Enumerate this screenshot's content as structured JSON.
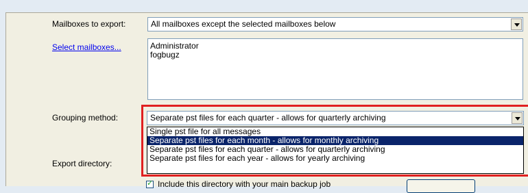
{
  "form": {
    "mailboxes_label": "Mailboxes to export:",
    "mailboxes_value": "All mailboxes except the selected mailboxes below",
    "select_mailboxes_link": "Select mailboxes...",
    "mailbox_list": [
      "Administrator",
      "fogbugz"
    ],
    "grouping_label": "Grouping method:",
    "grouping_value": "Separate pst files for each quarter - allows for quarterly archiving",
    "grouping_options": [
      "Single pst file for all messages",
      "Separate pst files for each month - allows for monthly archiving",
      "Separate pst files for each quarter - allows for quarterly archiving",
      "Separate pst files for each year - allows for yearly archiving"
    ],
    "grouping_highlighted_index": 1,
    "export_dir_label": "Export directory:",
    "include_dir_checkbox_label": "Include this directory with your main backup job",
    "include_dir_checked": true
  },
  "colors": {
    "highlight_box": "#e02020",
    "selection_bg": "#0a246a",
    "link": "#0000ee"
  }
}
